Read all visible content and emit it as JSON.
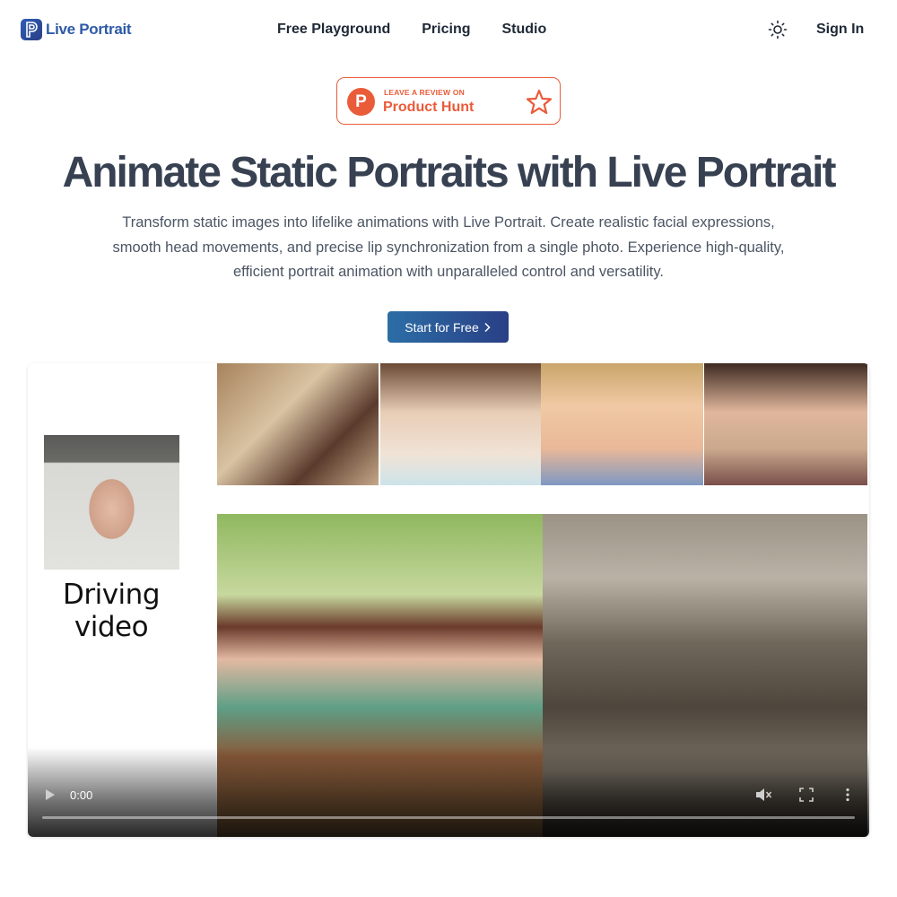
{
  "nav": {
    "logo_text": "Live Portrait",
    "links": [
      "Free Playground",
      "Pricing",
      "Studio"
    ],
    "sign_in": "Sign In"
  },
  "product_hunt": {
    "small_text": "LEAVE A REVIEW ON",
    "big_text": "Product Hunt",
    "letter": "P"
  },
  "hero": {
    "title": "Animate Static Portraits with Live Portrait",
    "subtitle": "Transform static images into lifelike animations with Live Portrait. Create realistic facial expressions, smooth head movements, and precise lip synchronization from a single photo. Experience high-quality, efficient portrait animation with unparalleled control and versatility.",
    "cta_label": "Start for Free"
  },
  "video": {
    "driver_label": "Driving video",
    "time": "0:00",
    "progress": 0
  },
  "colors": {
    "accent": "#2a3f86",
    "product_hunt": "#ea5b3a",
    "text": "#374151"
  },
  "icons": {
    "theme": "sun-icon",
    "cta": "chevron-right-icon",
    "play": "play-icon",
    "mute": "volume-mute-icon",
    "fullscreen": "fullscreen-icon",
    "more": "more-vertical-icon"
  }
}
